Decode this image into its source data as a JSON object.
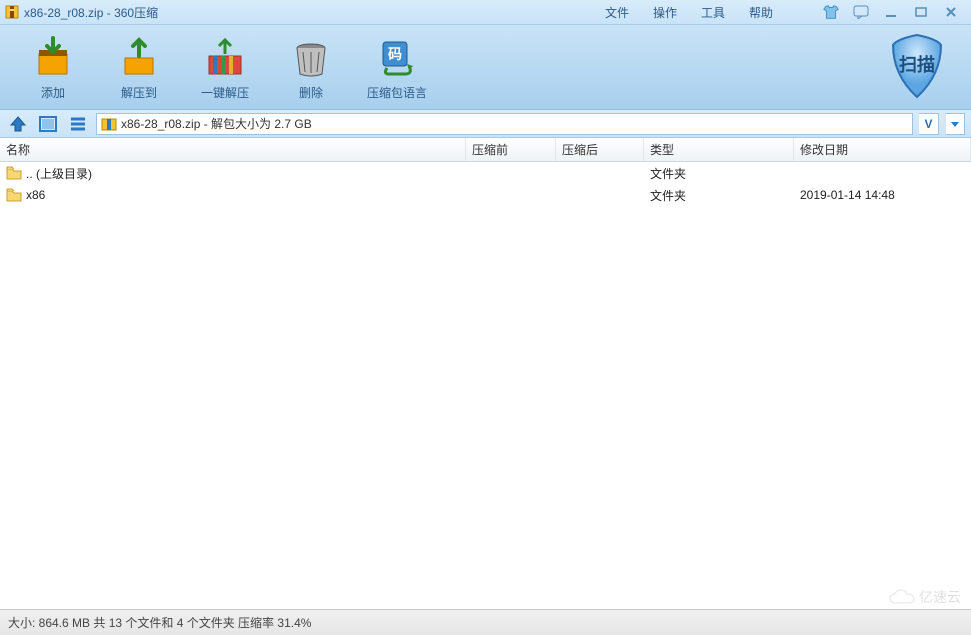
{
  "titlebar": {
    "filename": "x86-28_r08.zip",
    "app_name": "360压缩",
    "separator": " - ",
    "menu": {
      "file": "文件",
      "operate": "操作",
      "tool": "工具",
      "help": "帮助"
    }
  },
  "toolbar": {
    "add": "添加",
    "extract_to": "解压到",
    "one_click": "一键解压",
    "delete": "删除",
    "language": "压缩包语言",
    "scan": "扫描"
  },
  "pathbar": {
    "text": "x86-28_r08.zip - 解包大小为 2.7 GB",
    "v_label": "V"
  },
  "columns": {
    "name": "名称",
    "before": "压缩前",
    "after": "压缩后",
    "type": "类型",
    "date": "修改日期"
  },
  "rows": [
    {
      "name": ".. (上级目录)",
      "before": "",
      "after": "",
      "type": "文件夹",
      "date": ""
    },
    {
      "name": "x86",
      "before": "",
      "after": "",
      "type": "文件夹",
      "date": "2019-01-14 14:48"
    }
  ],
  "statusbar": {
    "text": "大小: 864.6 MB 共 13 个文件和 4 个文件夹 压缩率 31.4%"
  },
  "watermark": "亿速云"
}
